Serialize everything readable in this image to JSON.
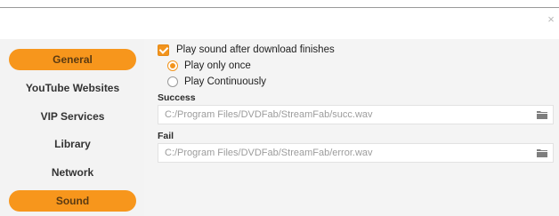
{
  "window": {
    "close_icon": "close-icon",
    "close_glyph": "×"
  },
  "sidebar": {
    "items": [
      {
        "label": "General",
        "active": true
      },
      {
        "label": "YouTube Websites",
        "active": false
      },
      {
        "label": "VIP Services",
        "active": false
      },
      {
        "label": "Library",
        "active": false
      },
      {
        "label": "Network",
        "active": false
      },
      {
        "label": "Sound",
        "active": true
      }
    ]
  },
  "sound": {
    "play_sound_label": "Play sound after download finishes",
    "play_sound_checked": true,
    "radio_options": [
      {
        "label": "Play only once",
        "checked": true
      },
      {
        "label": "Play Continuously",
        "checked": false
      }
    ],
    "success_label": "Success",
    "success_path": "C:/Program Files/DVDFab/StreamFab/succ.wav",
    "fail_label": "Fail",
    "fail_path": "C:/Program Files/DVDFab/StreamFab/error.wav",
    "folder_icon": "folder-icon"
  },
  "colors": {
    "accent": "#f7961c",
    "sidebar_bg": "#f3f3f3"
  }
}
